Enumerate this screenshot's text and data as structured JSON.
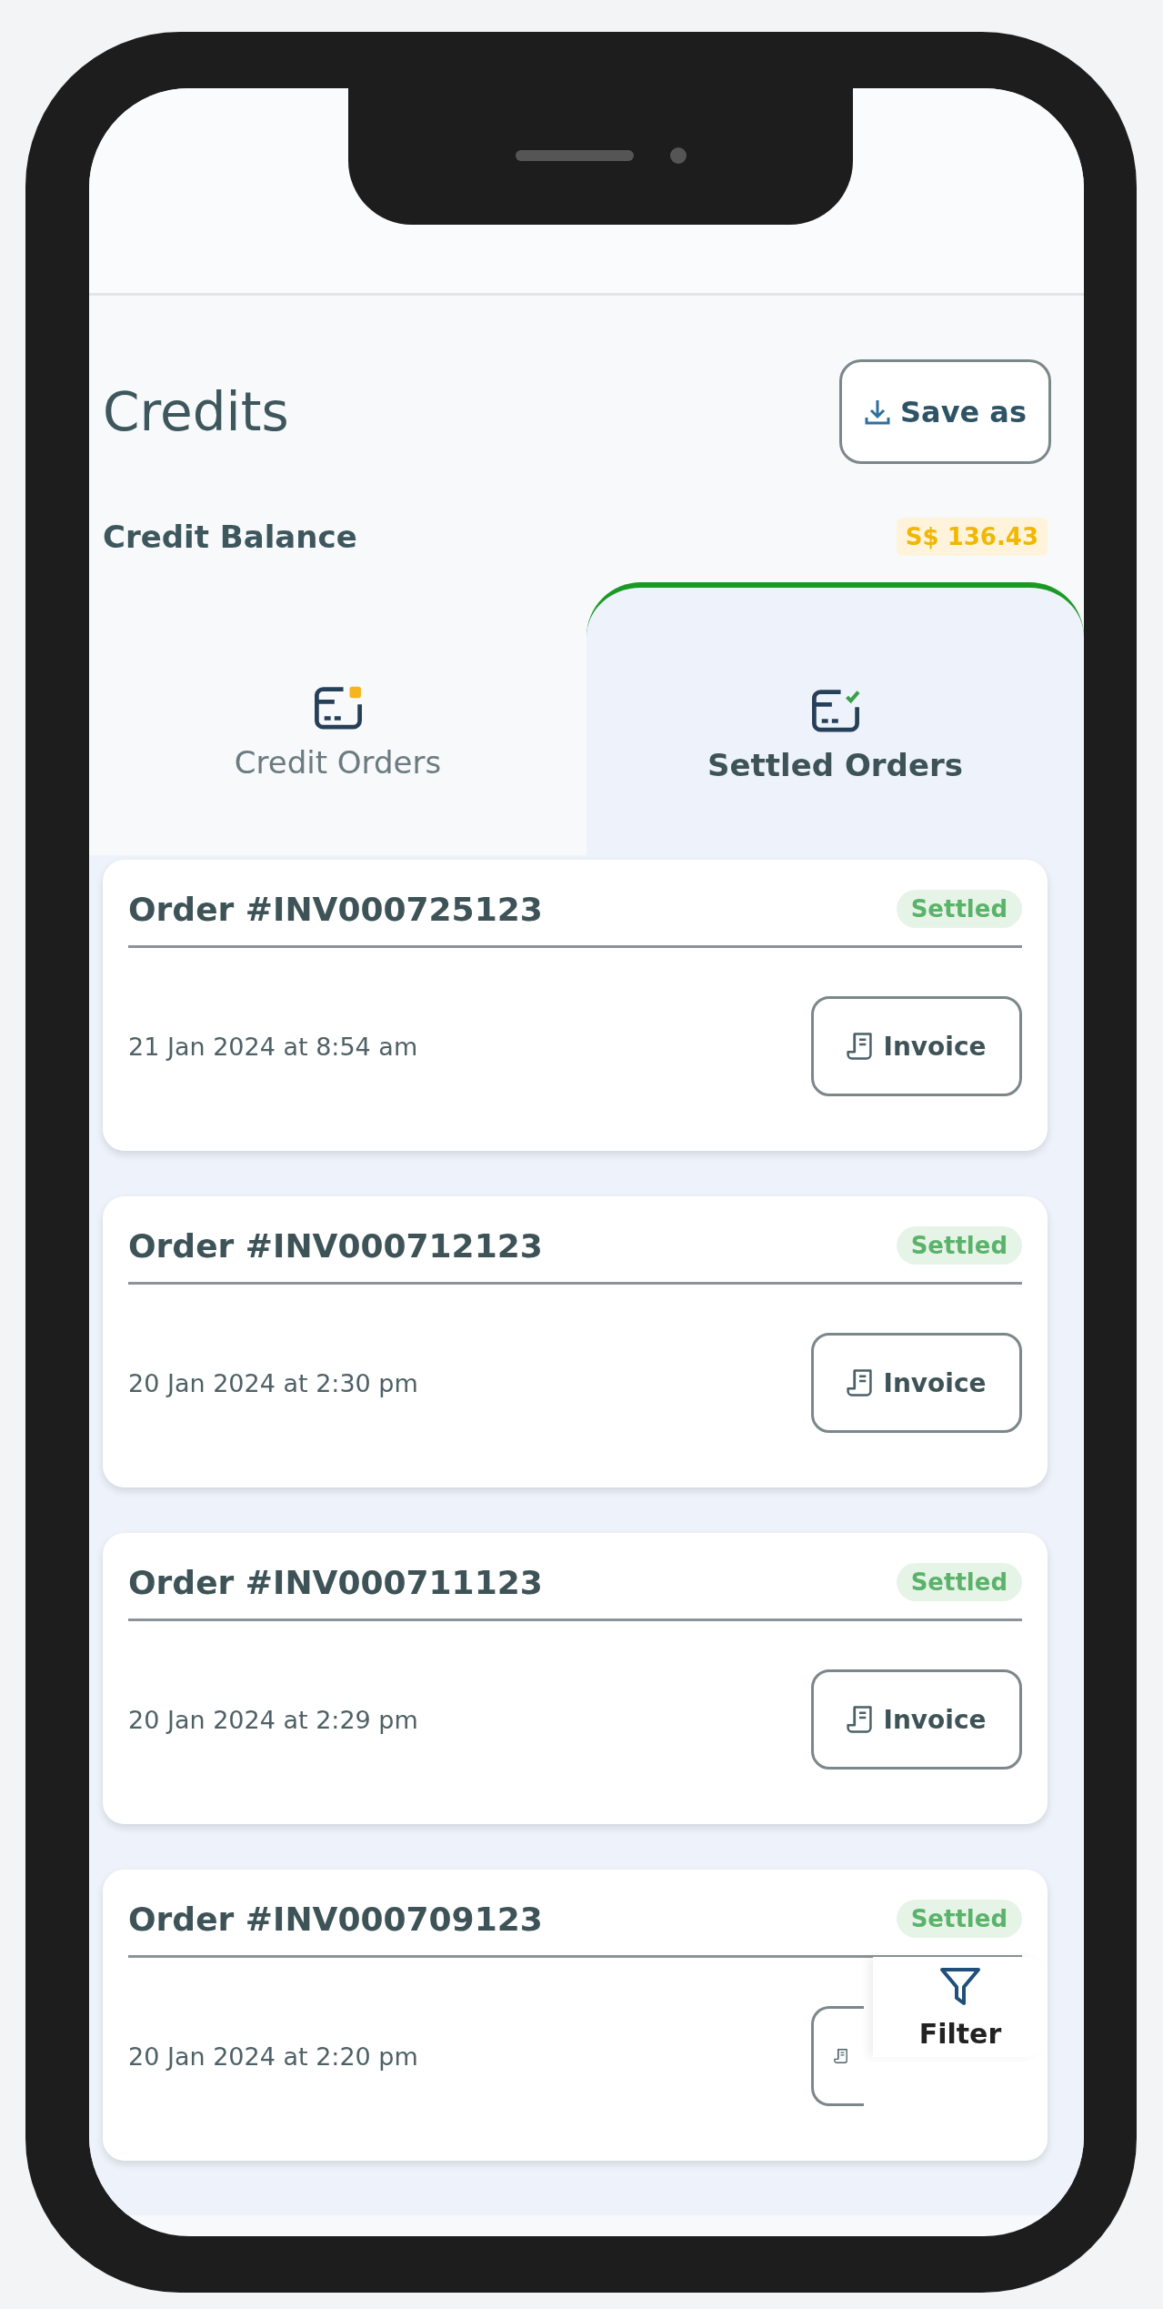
{
  "screen_title": "Credits",
  "save_button": {
    "label": "Save as"
  },
  "balance": {
    "label": "Credit Balance",
    "amount": "S$ 136.43"
  },
  "tabs": [
    {
      "label": "Credit Orders",
      "selected": false,
      "kind": "pending"
    },
    {
      "label": "Settled Orders",
      "selected": true,
      "kind": "settled"
    }
  ],
  "orders": [
    {
      "title": "Order #INV000725123",
      "status": "Settled",
      "date": "21 Jan 2024 at 8:54 am",
      "invoice_label": "Invoice"
    },
    {
      "title": "Order #INV000712123",
      "status": "Settled",
      "date": "20 Jan 2024 at 2:30 pm",
      "invoice_label": "Invoice"
    },
    {
      "title": "Order #INV000711123",
      "status": "Settled",
      "date": "20 Jan 2024 at 2:29 pm",
      "invoice_label": "Invoice"
    },
    {
      "title": "Order #INV000709123",
      "status": "Settled",
      "date": "20 Jan 2024 at 2:20 pm"
    }
  ],
  "filter_button": {
    "label": "Filter"
  }
}
